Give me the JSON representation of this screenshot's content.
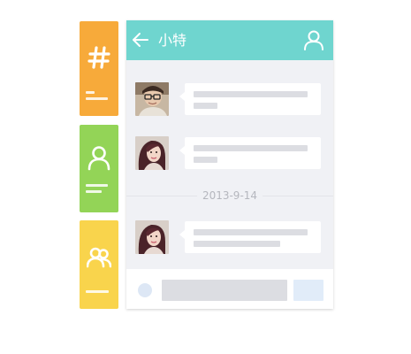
{
  "header": {
    "title": "小特",
    "background_color": "#6FD5CF",
    "back_icon": "arrow-left-icon",
    "profile_icon": "user-icon"
  },
  "side_tabs": [
    {
      "icon": "hash-icon",
      "color": "#F7AA3A"
    },
    {
      "icon": "user-icon",
      "color": "#93D457"
    },
    {
      "icon": "group-icon",
      "color": "#F9D44C"
    }
  ],
  "messages": [
    {
      "avatar": "avatar-man-glasses"
    },
    {
      "avatar": "avatar-woman"
    },
    {
      "avatar": "avatar-woman"
    }
  ],
  "divider": {
    "date": "2013-9-14"
  },
  "input_bar": {
    "emoji_icon": "emoji-icon"
  }
}
